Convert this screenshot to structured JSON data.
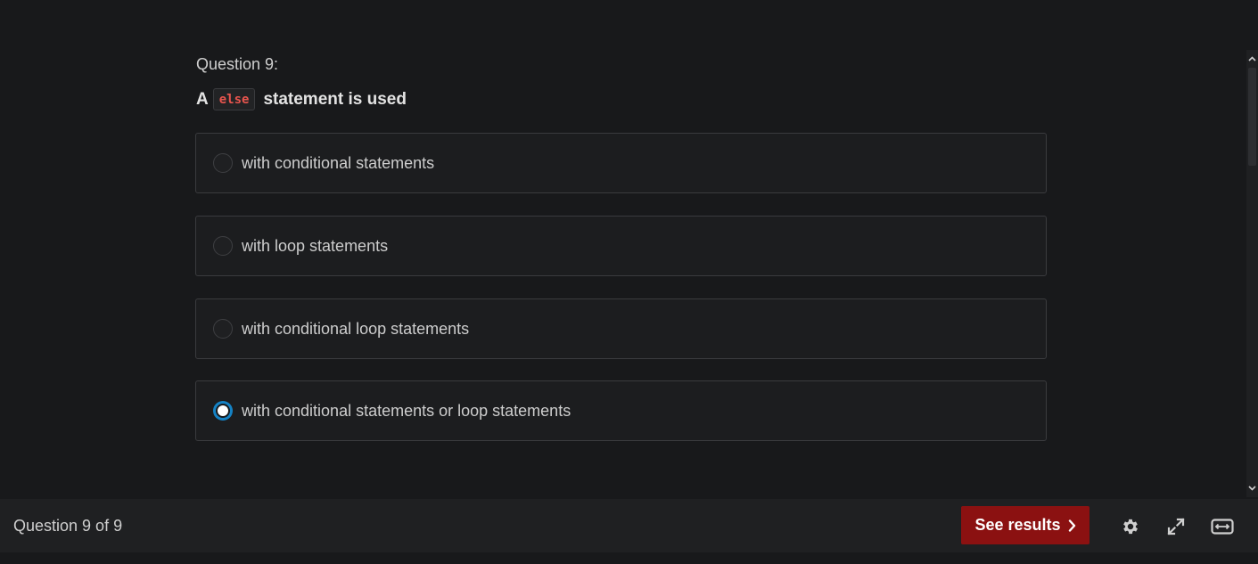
{
  "question": {
    "label": "Question 9:",
    "text_before": "A",
    "code": "else",
    "text_after": "statement is used"
  },
  "options": [
    {
      "label": "with conditional statements",
      "selected": false
    },
    {
      "label": "with loop statements",
      "selected": false
    },
    {
      "label": "with conditional loop statements",
      "selected": false
    },
    {
      "label": "with conditional statements or loop statements",
      "selected": true
    }
  ],
  "footer": {
    "progress": "Question 9 of 9",
    "see_results_label": "See results",
    "icons": [
      "gear-icon",
      "expand-icon",
      "fit-width-icon"
    ]
  },
  "colors": {
    "background": "#18191b",
    "accent_button": "#8b1111",
    "radio_selected": "#1582c4",
    "code_text": "#e8554e"
  }
}
